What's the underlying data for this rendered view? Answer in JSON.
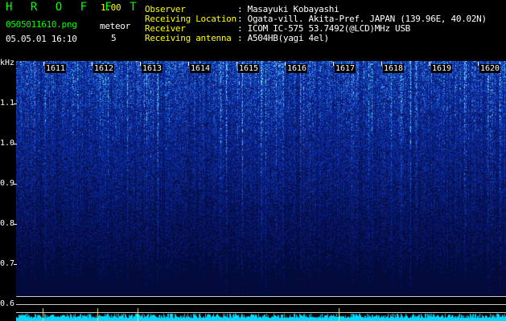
{
  "app": {
    "title": "H R O F F T",
    "version": "1.00"
  },
  "file": {
    "name": "0505011610.png",
    "datetime": "05.05.01 16:10"
  },
  "counter": {
    "label": "meteor",
    "value": "5"
  },
  "info": [
    {
      "key": "Observer",
      "value": ": Masayuki Kobayashi"
    },
    {
      "key": "Receiving Location",
      "value": ": Ogata-vill. Akita-Pref. JAPAN (139.96E, 40.02N)"
    },
    {
      "key": "Receiver",
      "value": ": ICOM IC-575 53.7492(@LCD)MHz USB"
    },
    {
      "key": "Receiving antenna",
      "value": ": A504HB(yagi 4el)"
    }
  ],
  "yaxis": {
    "unit": "kHz",
    "ticks": [
      "1.1",
      "1.0",
      "0.9",
      "0.8",
      "0.7",
      "0.6"
    ]
  },
  "xaxis": {
    "ticks": [
      "1611",
      "1612",
      "1613",
      "1614",
      "1615",
      "1616",
      "1617",
      "1618",
      "1619",
      "1620"
    ]
  },
  "colors": {
    "background": "#000000",
    "spectrogram_base": "#0a1a6e",
    "spectrogram_hot": "#7fd8ff",
    "label_green": "#00ff00",
    "label_yellow": "#ffff00",
    "level_trace": "#00e0ff"
  }
}
